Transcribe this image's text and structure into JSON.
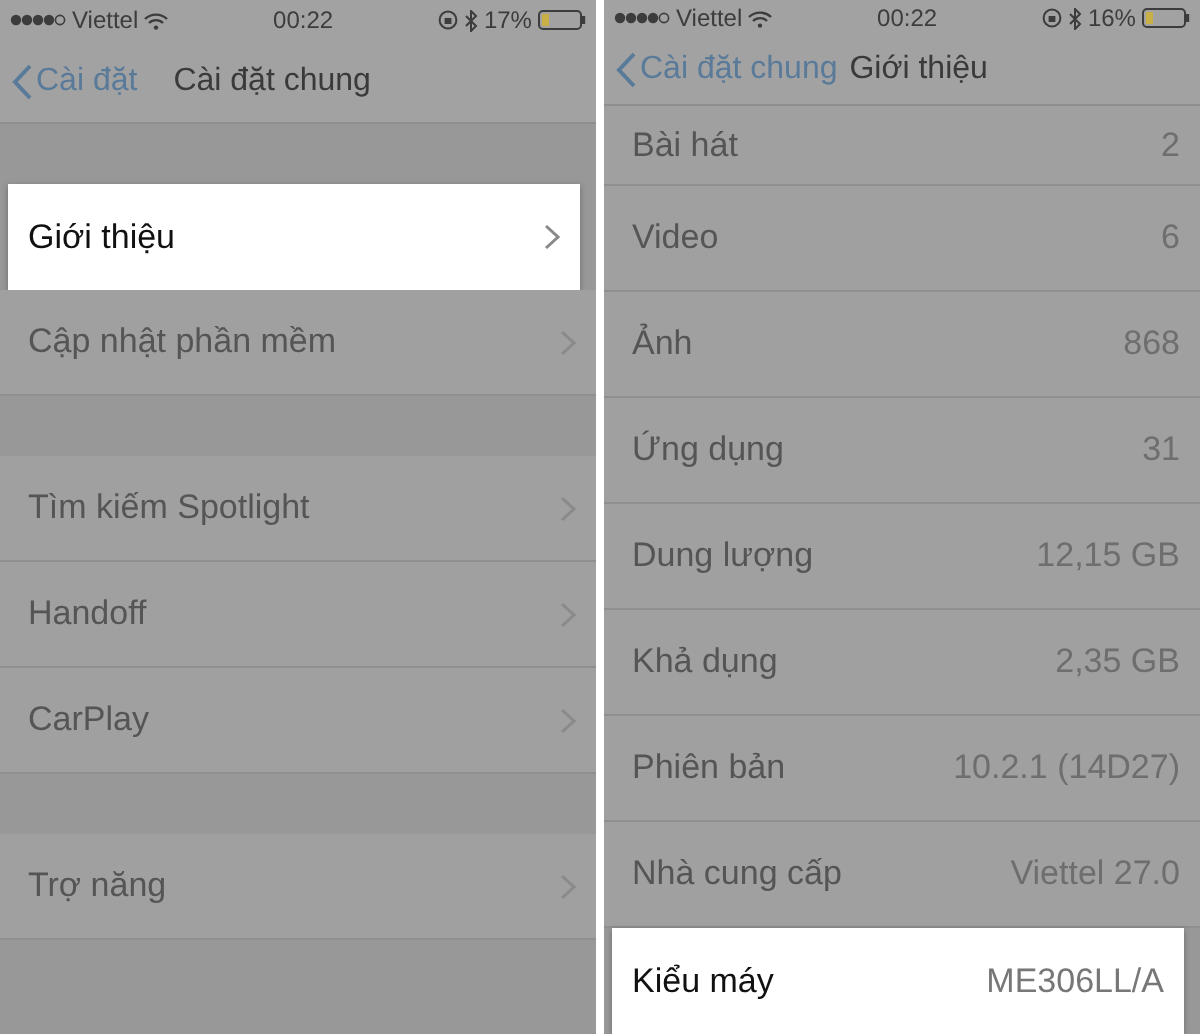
{
  "screens": [
    {
      "status_bar": {
        "carrier": "Viettel",
        "time": "00:22",
        "battery": "17%"
      },
      "nav": {
        "back": "Cài đặt",
        "title": "Cài đặt chung"
      },
      "groups": [
        [
          {
            "label": "Giới thiệu",
            "highlighted": true
          },
          {
            "label": "Cập nhật phần mềm",
            "highlighted": false
          }
        ],
        [
          {
            "label": "Tìm kiếm Spotlight",
            "highlighted": false
          },
          {
            "label": "Handoff",
            "highlighted": false
          },
          {
            "label": "CarPlay",
            "highlighted": false
          }
        ],
        [
          {
            "label": "Trợ năng",
            "highlighted": false
          }
        ]
      ]
    },
    {
      "status_bar": {
        "carrier": "Viettel",
        "time": "00:22",
        "battery": "16%"
      },
      "nav": {
        "back": "Cài đặt chung",
        "title": "Giới thiệu"
      },
      "rows": [
        {
          "label": "Bài hát",
          "value": "2",
          "highlighted": false
        },
        {
          "label": "Video",
          "value": "6",
          "highlighted": false
        },
        {
          "label": "Ảnh",
          "value": "868",
          "highlighted": false
        },
        {
          "label": "Ứng dụng",
          "value": "31",
          "highlighted": false
        },
        {
          "label": "Dung lượng",
          "value": "12,15 GB",
          "highlighted": false
        },
        {
          "label": "Khả dụng",
          "value": "2,35 GB",
          "highlighted": false
        },
        {
          "label": "Phiên bản",
          "value": "10.2.1 (14D27)",
          "highlighted": false
        },
        {
          "label": "Nhà cung cấp",
          "value": "Viettel 27.0",
          "highlighted": false
        },
        {
          "label": "Kiểu máy",
          "value": "ME306LL/A",
          "highlighted": true
        }
      ]
    }
  ]
}
